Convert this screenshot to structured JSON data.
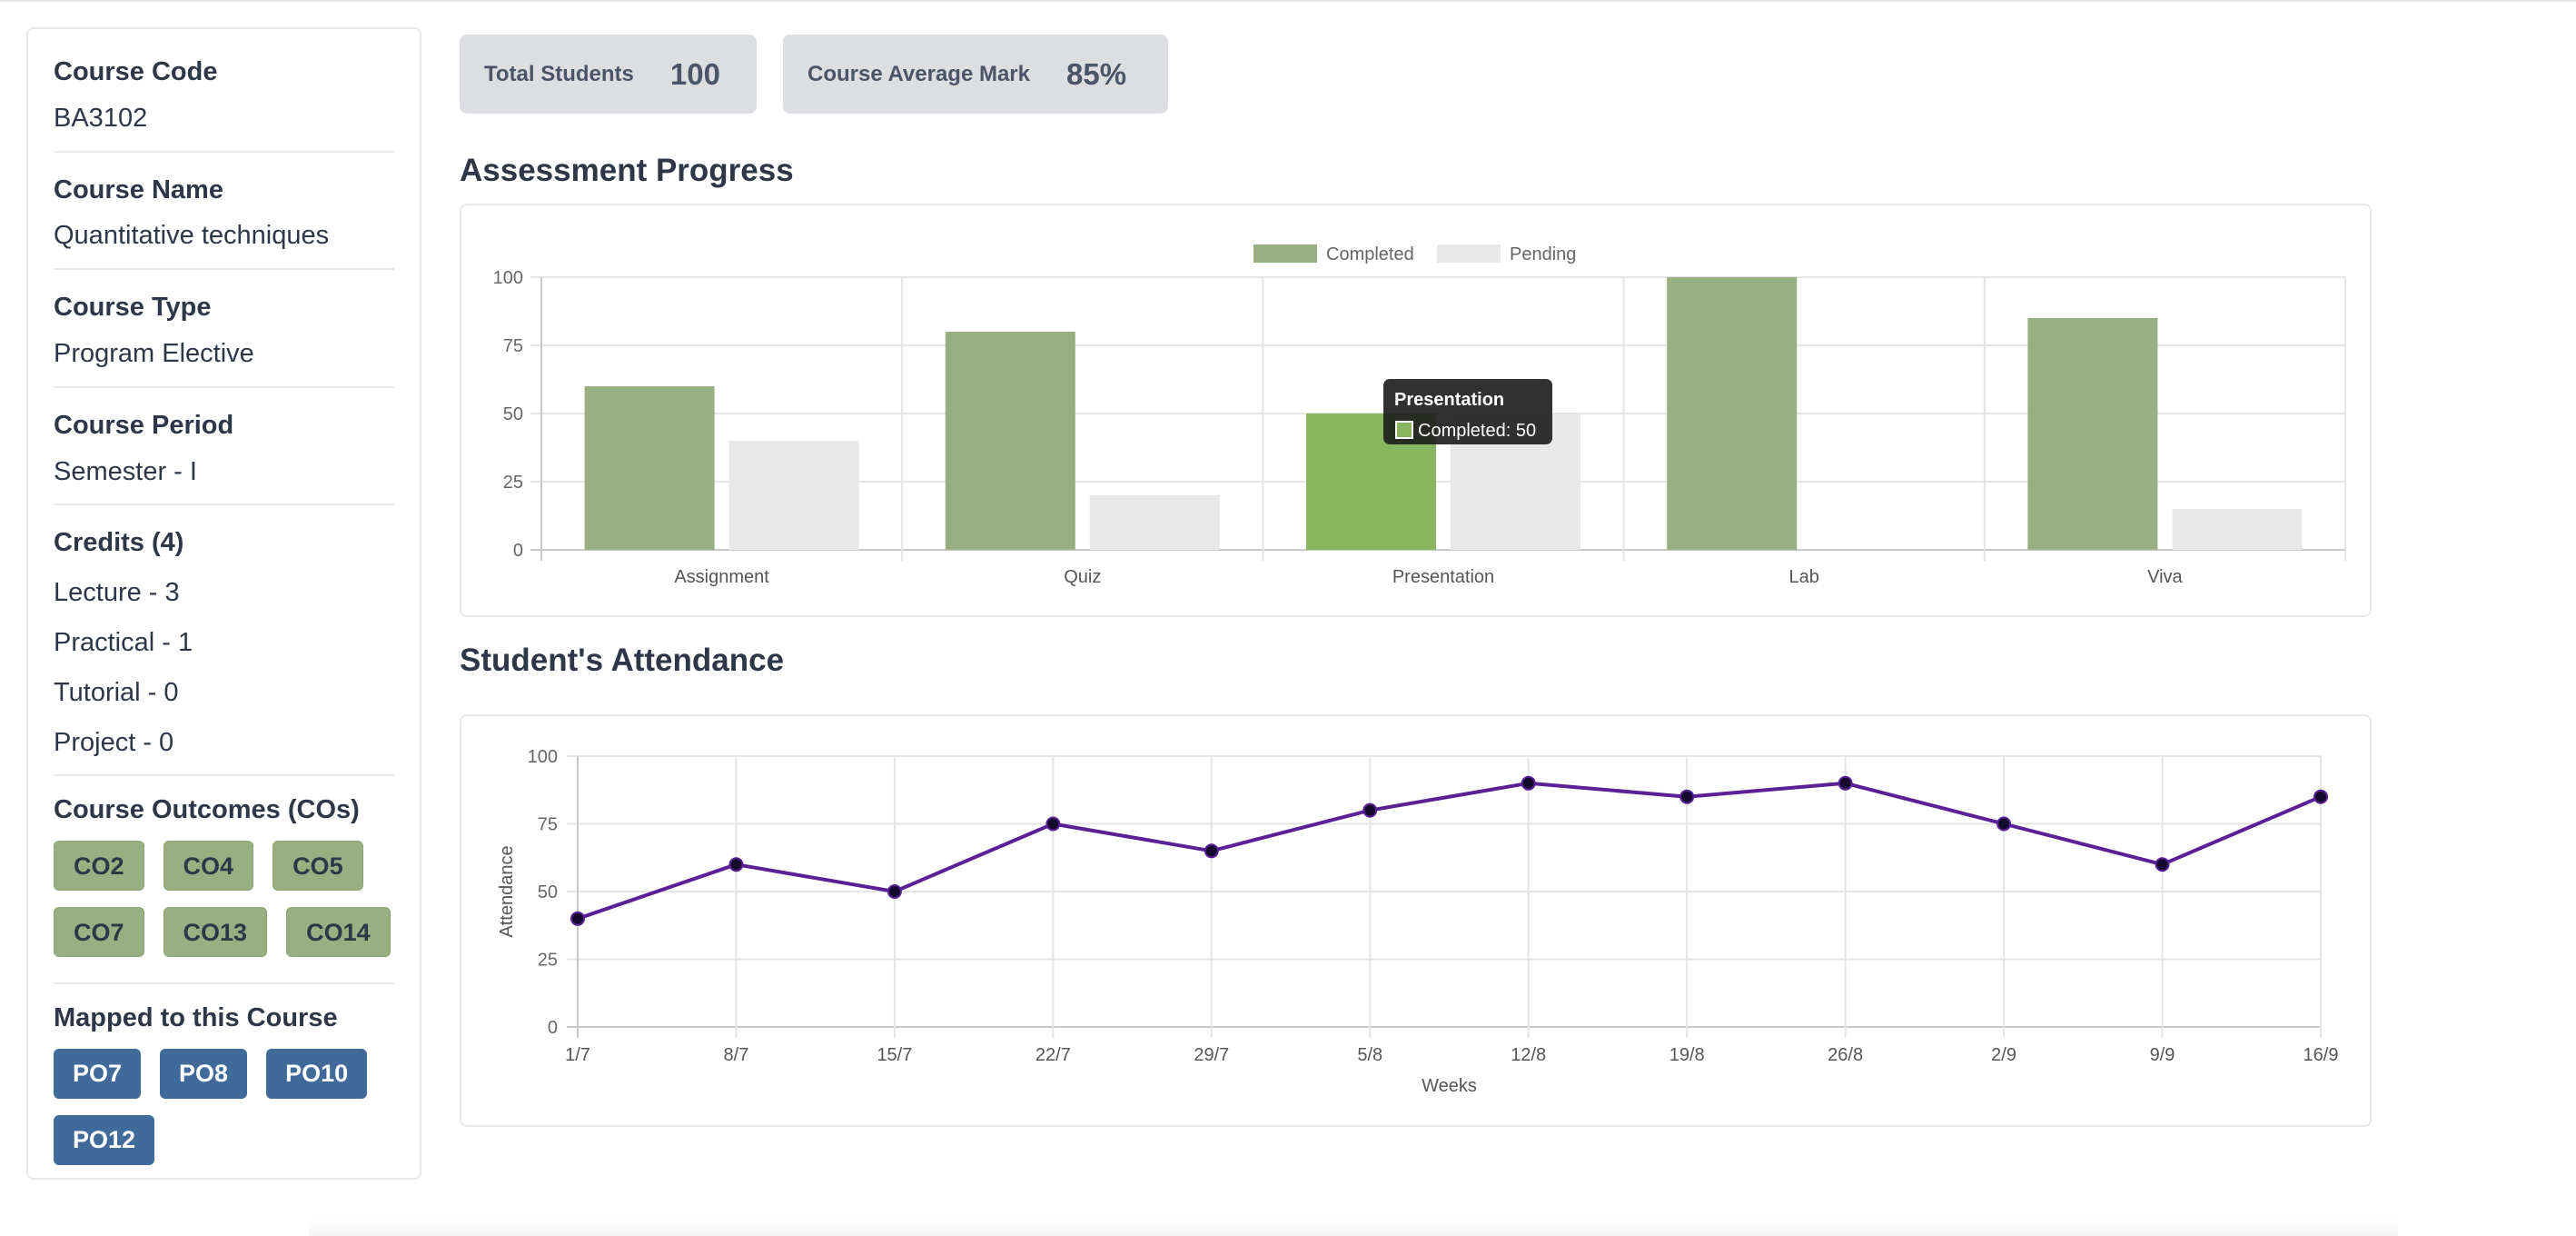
{
  "sidebar": {
    "course_code": {
      "label": "Course Code",
      "value": "BA3102"
    },
    "course_name": {
      "label": "Course Name",
      "value": "Quantitative techniques"
    },
    "course_type": {
      "label": "Course Type",
      "value": "Program Elective"
    },
    "course_period": {
      "label": "Course Period",
      "value": "Semester - I"
    },
    "credits": {
      "label": "Credits (4)",
      "items": [
        "Lecture - 3",
        "Practical - 1",
        "Tutorial - 0",
        "Project - 0"
      ]
    },
    "course_outcomes": {
      "label": "Course Outcomes (COs)",
      "chips": [
        "CO2",
        "CO4",
        "CO5",
        "CO7",
        "CO13",
        "CO14"
      ]
    },
    "mapped": {
      "label": "Mapped to this Course",
      "chips": [
        "PO7",
        "PO8",
        "PO10",
        "PO12"
      ]
    }
  },
  "stats": {
    "total_students": {
      "label": "Total Students",
      "value": "100"
    },
    "average_mark": {
      "label": "Course Average Mark",
      "value": "85%"
    }
  },
  "sections": {
    "assessment_title": "Assessment Progress",
    "attendance_title": "Student's Attendance"
  },
  "colors": {
    "completed": "#98b081",
    "completed_hover": "#88b660",
    "pending": "#e8e8e8",
    "line": "#5b1f96",
    "po_chip": "#3f6a9a"
  },
  "tooltip": {
    "title": "Presentation",
    "line": "Completed: 50"
  },
  "chart_data": [
    {
      "type": "bar",
      "categories": [
        "Assignment",
        "Quiz",
        "Presentation",
        "Lab",
        "Viva"
      ],
      "series": [
        {
          "name": "Completed",
          "values": [
            60,
            80,
            50,
            100,
            85
          ]
        },
        {
          "name": "Pending",
          "values": [
            40,
            20,
            50,
            0,
            15
          ]
        }
      ],
      "ylim": [
        0,
        100
      ],
      "yticks": [
        "100",
        "75",
        "50",
        "25",
        "0"
      ],
      "legend": "top-center",
      "grid": true
    },
    {
      "type": "line",
      "x": [
        "1/7",
        "8/7",
        "15/7",
        "22/7",
        "29/7",
        "5/8",
        "12/8",
        "19/8",
        "26/8",
        "2/9",
        "9/9",
        "16/9"
      ],
      "series": [
        {
          "values": [
            40,
            60,
            50,
            75,
            65,
            80,
            90,
            85,
            90,
            75,
            60,
            85
          ]
        }
      ],
      "xlabel": "Weeks",
      "ylabel": "Attendance",
      "ylim": [
        0,
        100
      ],
      "yticks": [
        "100",
        "75",
        "50",
        "25",
        "0"
      ],
      "grid": true
    }
  ]
}
